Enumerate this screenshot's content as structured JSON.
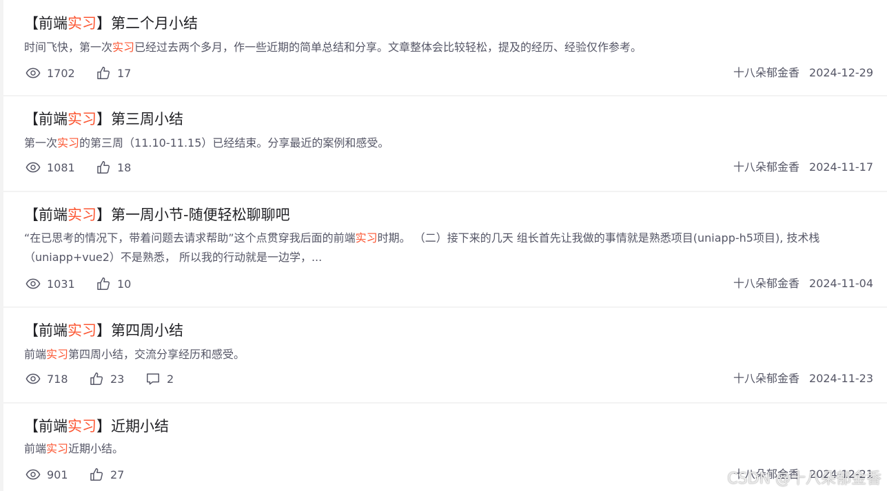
{
  "articles": [
    {
      "title_prefix": "【前端",
      "title_hl": "实习",
      "title_rest": "】第二个月小结",
      "summary": [
        {
          "text": "时间飞快，第一次",
          "hl": false
        },
        {
          "text": "实习",
          "hl": true
        },
        {
          "text": "已经过去两个多月，作一些近期的简单总结和分享。文章整体会比较轻松，提及的经历、经验仅作参考。",
          "hl": false
        }
      ],
      "views": "1702",
      "likes": "17",
      "comments": null,
      "author": "十八朵郁金香",
      "date": "2024-12-29"
    },
    {
      "title_prefix": "【前端",
      "title_hl": "实习",
      "title_rest": "】第三周小结",
      "summary": [
        {
          "text": "第一次",
          "hl": false
        },
        {
          "text": "实习",
          "hl": true
        },
        {
          "text": "的第三周（11.10-11.15）已经结束。分享最近的案例和感受。",
          "hl": false
        }
      ],
      "views": "1081",
      "likes": "18",
      "comments": null,
      "author": "十八朵郁金香",
      "date": "2024-11-17"
    },
    {
      "title_prefix": "【前端",
      "title_hl": "实习",
      "title_rest": "】第一周小节-随便轻松聊聊吧",
      "summary": [
        {
          "text": "“在已思考的情况下，带着问题去请求帮助”这个点贯穿我后面的前端",
          "hl": false
        },
        {
          "text": "实习",
          "hl": true
        },
        {
          "text": "时期。 （二）接下来的几天 组长首先让我做的事情就是熟悉项目(uniapp-h5项目), 技术栈（uniapp+vue2）不是熟悉， 所以我的行动就是一边学，...",
          "hl": false
        }
      ],
      "views": "1031",
      "likes": "10",
      "comments": null,
      "author": "十八朵郁金香",
      "date": "2024-11-04"
    },
    {
      "title_prefix": "【前端",
      "title_hl": "实习",
      "title_rest": "】第四周小结",
      "summary": [
        {
          "text": "前端",
          "hl": false
        },
        {
          "text": "实习",
          "hl": true
        },
        {
          "text": "第四周小结，交流分享经历和感受。",
          "hl": false
        }
      ],
      "views": "718",
      "likes": "23",
      "comments": "2",
      "author": "十八朵郁金香",
      "date": "2024-11-23"
    },
    {
      "title_prefix": "【前端",
      "title_hl": "实习",
      "title_rest": "】近期小结",
      "summary": [
        {
          "text": "前端",
          "hl": false
        },
        {
          "text": "实习",
          "hl": true
        },
        {
          "text": "近期小结。",
          "hl": false
        }
      ],
      "views": "901",
      "likes": "27",
      "comments": null,
      "author": "十八朵郁金香",
      "date": "2024-12-21"
    }
  ],
  "watermark": "CSDN @十八朵郁金香",
  "colors": {
    "highlight": "#fc5531",
    "text": "#222226",
    "muted": "#555666",
    "divider": "#f3f3f3"
  },
  "icons": {
    "views": "eye-icon",
    "likes": "thumbs-up-icon",
    "comments": "comment-bubble-icon"
  }
}
